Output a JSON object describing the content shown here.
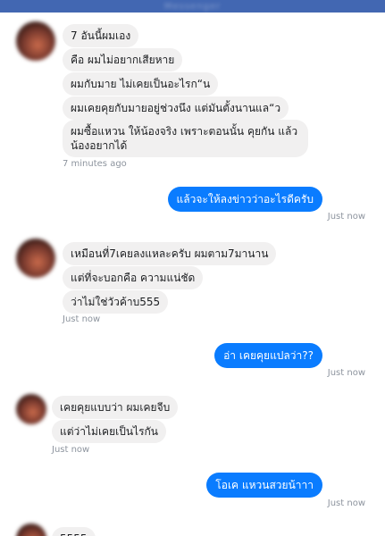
{
  "header": {
    "title": "Messenger"
  },
  "thread": {
    "group1": {
      "messages": [
        "7 อันนี้ผมเอง",
        "คือ ผมไม่อยากเสียหาย",
        "ผมกับมาย ไม่เคยเป็นอะไรก“น",
        "ผมเคยคุยกับมายอยู่ช่วงนึง แต่มันตั้งนานแล“ว",
        "ผมซื้อแหวน ให้น้องจริง เพราะตอนนั้น คุยกัน แล้วน้องอยากได้"
      ],
      "time": "7 minutes ago"
    },
    "out1": {
      "text": "แล้วจะให้ลงข่าวว่าอะไรดีครับ",
      "time": "Just now"
    },
    "group2": {
      "messages": [
        "เหมือนที่7เคยลงแหละครับ ผมตาม7มานาน",
        "แต่ที่จะบอกคือ ความแน่ชัด",
        "ว่าไม่ใช่วัวค้าบ555"
      ],
      "time": "Just now"
    },
    "out2": {
      "text": "อ่า เคยคุยแปลว่า??",
      "time": "Just now"
    },
    "group3": {
      "messages": [
        "เคยคุยแบบว่า ผมเคยจีบ",
        "แต่ว่าไม่เคยเป็นไรกัน"
      ],
      "time": "Just now"
    },
    "out3": {
      "text": "โอเค แหวนสวยน้าาา",
      "time": "Just now"
    },
    "group4": {
      "messages": [
        "5555"
      ]
    }
  },
  "colors": {
    "header": "#4267b2",
    "outgoing": "#0a7cff",
    "incoming": "#f1f0f0",
    "meta": "#8d949e"
  }
}
